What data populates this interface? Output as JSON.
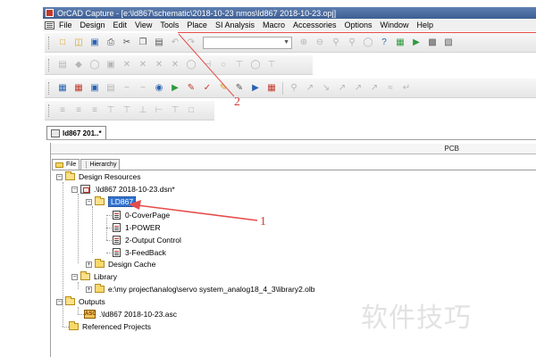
{
  "window": {
    "title": "OrCAD Capture - [e:\\ld867\\schematic\\2018-10-23 nmos\\ld867 2018-10-23.opj]",
    "app_icon": "orcad-app-icon"
  },
  "menu": {
    "doc_icon": "document-icon",
    "items": [
      "File",
      "Design",
      "Edit",
      "View",
      "Tools",
      "Place",
      "SI Analysis",
      "Macro",
      "Accessories",
      "Options",
      "Window",
      "Help"
    ]
  },
  "annotations": {
    "label_1": "1",
    "label_2": "2",
    "color": "#d33a3a"
  },
  "toolbar_row1": {
    "icons": [
      "new-icon",
      "open-icon",
      "save-icon",
      "print-icon",
      "cut-icon",
      "copy-icon",
      "paste-icon",
      "undo-icon",
      "redo-icon"
    ],
    "zoom_icons": [
      "zoom-in-icon",
      "zoom-out-icon",
      "zoom-area-icon",
      "zoom-all-icon",
      "zoom-fit-icon",
      "help-icon",
      "netlist-icon",
      "annotate-icon",
      "drc-icon",
      "bom-icon"
    ]
  },
  "document_tab": {
    "label": "ld867 201..*"
  },
  "project": {
    "column_header": "PCB",
    "tabs": [
      {
        "label": "File",
        "active": true
      },
      {
        "label": "Hierarchy",
        "active": false
      }
    ],
    "tree": {
      "design_resources": "Design Resources",
      "design_file": ".\\ld867 2018-10-23.dsn*",
      "schematic": "LD867",
      "pages": [
        "0-CoverPage",
        "1-POWER",
        "2-Output Control",
        "3-FeedBack"
      ],
      "design_cache": "Design Cache",
      "library": "Library",
      "library_file": "e:\\my project\\analog\\servo system_analog18_4_3\\library2.olb",
      "outputs": "Outputs",
      "output_file": ".\\ld867 2018-10-23.asc",
      "referenced_projects": "Referenced Projects"
    }
  },
  "watermark": "软件技巧",
  "colors": {
    "selection": "#3274d0",
    "folder": "#f8d869",
    "annotation": "#e64c4c"
  }
}
